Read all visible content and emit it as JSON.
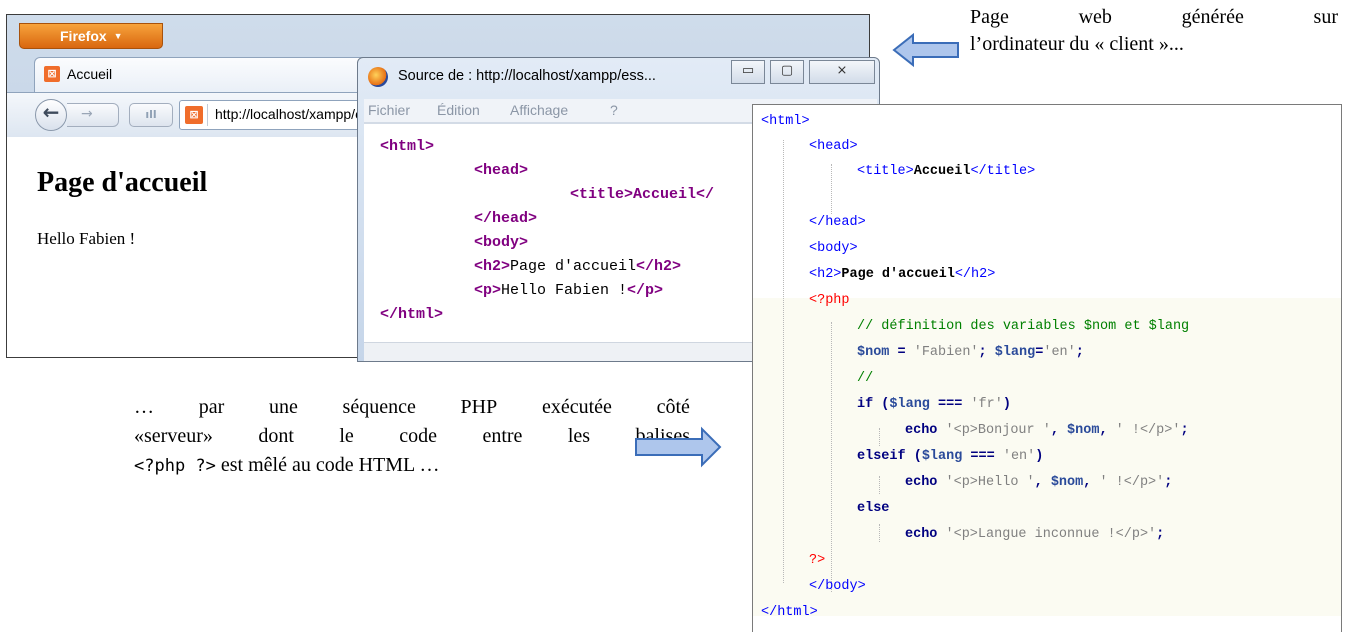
{
  "firefox": {
    "menu_button": "Firefox",
    "menu_arrow": "▼",
    "tab_label": "Accueil",
    "tab_icon": "xampp-icon",
    "url": "http://localhost/xampp/essai.php",
    "page_heading": "Page d'accueil",
    "page_text": "Hello Fabien !"
  },
  "source_window": {
    "title": "Source de : http://localhost/xampp/ess...",
    "controls": {
      "minimize": "▭",
      "maximize": "▢",
      "close": "⨯"
    },
    "menu": [
      "Fichier",
      "Édition",
      "Affichage",
      "?"
    ],
    "lines": {
      "l1": "<html>",
      "l2": "<head>",
      "l3": "<title>Accueil</",
      "l4": "</head>",
      "l5": "<body>",
      "l6_open": "<h2>",
      "l6_text": "Page d'accueil",
      "l6_close": "</h2>",
      "l7_open": "<p>",
      "l7_text": "Hello Fabien !",
      "l7_close": "</p>",
      "l8": "</html>"
    }
  },
  "php_code": {
    "html_open": "<html>",
    "head_open": "<head>",
    "title_open": "<title>",
    "title_text": "Accueil",
    "title_close": "</title>",
    "head_close": "</head>",
    "body_open": "<body>",
    "h2_open": "<h2>",
    "h2_text": "Page d'accueil",
    "h2_close": "</h2>",
    "php_open": "<?php",
    "comment": "// définition des variables $nom et $lang",
    "assign_var1": "$nom",
    "assign_eq1": " = ",
    "assign_str1": "'Fabien'",
    "assign_semi1": "; ",
    "assign_var2": "$lang",
    "assign_eq2": "=",
    "assign_str2": "'en'",
    "assign_semi2": ";",
    "comment2": "//",
    "if_kw": "if",
    "if_open": " (",
    "if_var": "$lang",
    "if_op": " === ",
    "if_str": "'fr'",
    "if_close": ")",
    "echo1_kw": "echo",
    "echo1_s1": " '<p>Bonjour '",
    "echo1_c1": ", ",
    "echo1_var": "$nom",
    "echo1_c2": ", ",
    "echo1_s2": "' !</p>'",
    "echo1_end": ";",
    "elseif_kw": "elseif",
    "elseif_open": " (",
    "elseif_var": "$lang",
    "elseif_op": " === ",
    "elseif_str": "'en'",
    "elseif_close": ")",
    "echo2_kw": "echo",
    "echo2_s1": " '<p>Hello '",
    "echo2_c1": ", ",
    "echo2_var": "$nom",
    "echo2_c2": ", ",
    "echo2_s2": "' !</p>'",
    "echo2_end": ";",
    "else_kw": "else",
    "echo3_kw": "echo",
    "echo3_s1": " '<p>Langue inconnue !</p>'",
    "echo3_end": ";",
    "php_close": "?>",
    "body_close": "</body>",
    "html_close": "</html>"
  },
  "annotations": {
    "top_w1": "Page",
    "top_w2": "web",
    "top_w3": "générée",
    "top_w4": "sur",
    "top_line2": "l’ordinateur du « client »...",
    "bottom_l1": [
      "…",
      "par",
      "une",
      "séquence",
      "PHP",
      "exécutée",
      "côté"
    ],
    "bottom_l2": [
      "«serveur»",
      "dont",
      "le",
      "code",
      "entre",
      "les",
      "balises"
    ],
    "bottom_l3_code": "<?php ?>",
    "bottom_l3_text": " est mêlé au code HTML …"
  },
  "colors": {
    "arrow_fill": "#aec6ec",
    "arrow_stroke": "#3b6db8",
    "firefox_orange": "#e8821e"
  }
}
